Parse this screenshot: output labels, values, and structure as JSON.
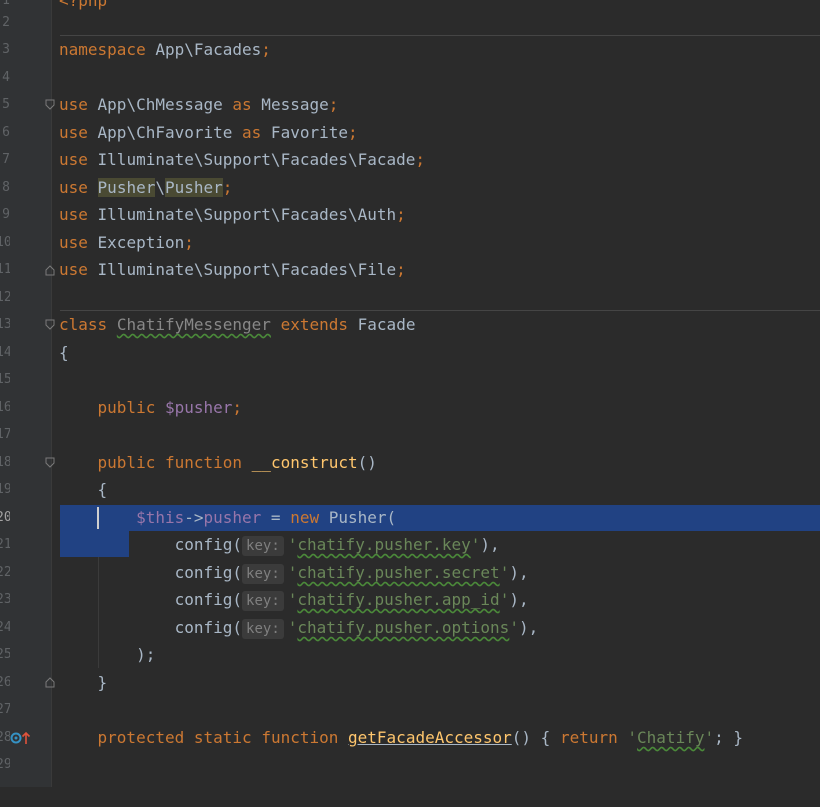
{
  "gutter": {
    "line_numbers": [
      "1",
      "2",
      "3",
      "4",
      "5",
      "6",
      "7",
      "8",
      "9",
      "10",
      "11",
      "12",
      "13",
      "14",
      "15",
      "16",
      "17",
      "18",
      "19",
      "20",
      "21",
      "22",
      "23",
      "24",
      "25",
      "26",
      "27",
      "28",
      "29"
    ],
    "active_line": "20",
    "markers": [
      "fold-marker-icon",
      "implements-marker-icon"
    ]
  },
  "code": {
    "l1": "<?php",
    "l3_kw": "namespace",
    "l3_ns": " App\\Facades",
    "l3_semi": ";",
    "use": "use",
    "as": "as",
    "l5_a": " App\\ChMessage ",
    "l5_b": " Message",
    "l6_a": " App\\ChFavorite ",
    "l6_b": " Favorite",
    "l7_a": " Illuminate\\Support\\Facades\\Facade",
    "l8_sp": " ",
    "l8_p1": "Pusher",
    "l8_bs": "\\",
    "l8_p2": "Pusher",
    "l9_a": " Illuminate\\Support\\Facades\\Auth",
    "l10_a": " Exception",
    "l11_a": " Illuminate\\Support\\Facades\\File",
    "semi": ";",
    "l13_class": "class",
    "l13_name": "ChatifyMessenger",
    "l13_extends": "extends",
    "l13_facade": "Facade",
    "open_brace": "{",
    "close_brace": "}",
    "public": "public",
    "pusher_var": "$pusher",
    "function": "function",
    "construct": "__construct",
    "parens": "()",
    "this": "$this",
    "arrow": "->",
    "pusher_prop": "pusher",
    "assign": " = ",
    "new": "new",
    "pusher_class": " Pusher(",
    "config": "config(",
    "hint_key": "key:",
    "q": "'",
    "cfg1": "chatify.pusher.key",
    "cfg2": "chatify.pusher.secret",
    "cfg3": "chatify.pusher.app_id",
    "cfg4": "chatify.pusher.options",
    "close_arg": "),",
    "close_call": ");",
    "protected": "protected",
    "static": "static",
    "accessor": "getFacadeAccessor",
    "accessor_tail": "() { ",
    "return": "return",
    "chatify": "Chatify",
    "tail": "; }"
  },
  "colors": {
    "background": "#2b2b2b",
    "keyword": "#cc7832",
    "variable": "#9876aa",
    "string": "#6a8759",
    "function": "#ffc66d",
    "text": "#a9b7c6",
    "selection": "#214283"
  }
}
